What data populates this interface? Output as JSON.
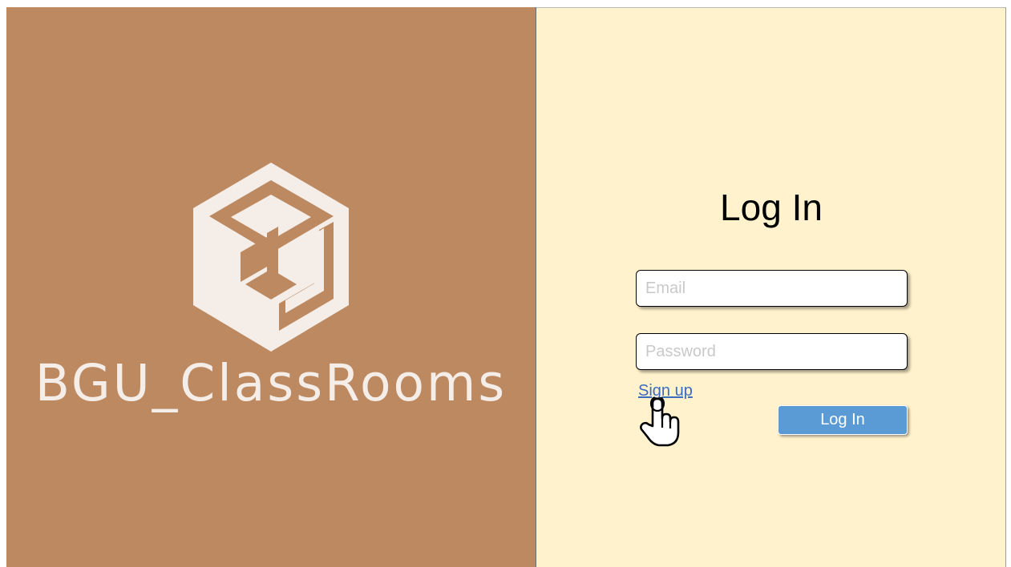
{
  "colors": {
    "left_bg": "#bd8961",
    "right_bg": "#fff2cc",
    "logo_fill": "#f4ede8",
    "button_bg": "#5b9bd5",
    "link": "#3a6cc2"
  },
  "brand": {
    "name": "BGU_ClassRooms",
    "logo_icon": "cube-logo-icon"
  },
  "login": {
    "title": "Log In",
    "email_placeholder": "Email",
    "password_placeholder": "Password",
    "signup_label": "Sign up",
    "submit_label": "Log In",
    "cursor_icon": "hand-pointer-icon"
  }
}
